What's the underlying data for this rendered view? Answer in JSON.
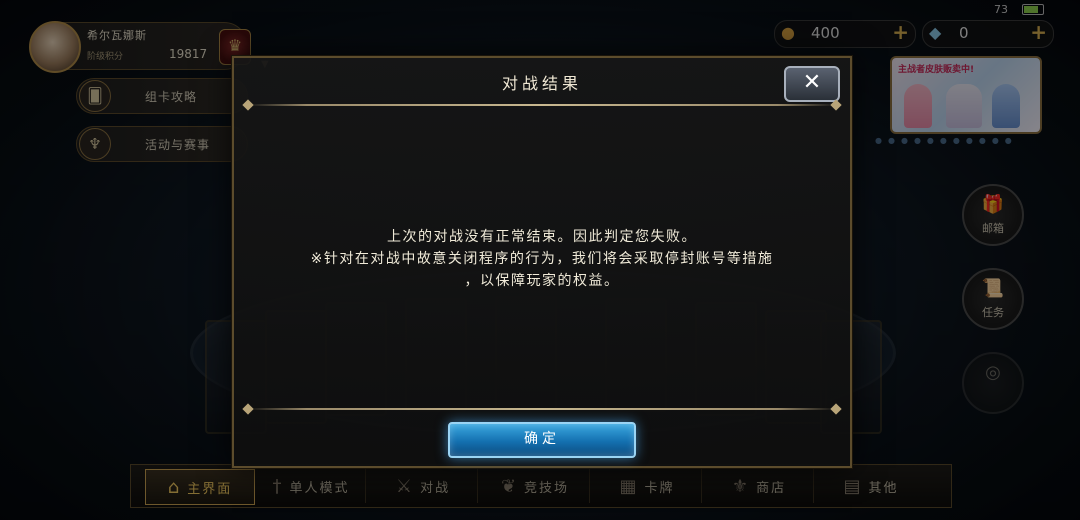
{
  "status_bar": {
    "battery": "73"
  },
  "profile": {
    "name": "希尔瓦娜斯",
    "rank_label": "阶级积分",
    "rank_value": "19817"
  },
  "side_buttons": [
    {
      "label": "组卡攻略",
      "icon": "cards-icon"
    },
    {
      "label": "活动与赛事",
      "icon": "trophy-icon"
    }
  ],
  "resources": {
    "gold": {
      "value": "400",
      "icon": "gold-coin-icon"
    },
    "crystal": {
      "value": "0",
      "icon": "crystal-icon"
    }
  },
  "banner": {
    "title": "主战者皮肤贩卖中!"
  },
  "right_buttons": [
    {
      "label": "邮箱",
      "icon": "gift-icon"
    },
    {
      "label": "任务",
      "icon": "scroll-icon"
    }
  ],
  "nav": [
    {
      "label": "主界面",
      "icon": "home-icon",
      "active": true
    },
    {
      "label": "单人模式",
      "icon": "sword-icon",
      "active": false
    },
    {
      "label": "对战",
      "icon": "crossed-swords-icon",
      "active": false
    },
    {
      "label": "竞技场",
      "icon": "laurel-icon",
      "active": false
    },
    {
      "label": "卡牌",
      "icon": "cards-icon",
      "active": false
    },
    {
      "label": "商店",
      "icon": "shop-icon",
      "active": false
    },
    {
      "label": "其他",
      "icon": "more-icon",
      "active": false
    }
  ],
  "dialog": {
    "title": "对战结果",
    "message_lines": [
      "上次的对战没有正常结束。因此判定您失败。",
      "※针对在对战中故意关闭程序的行为，我们将会采取停封账号等措施",
      "，以保障玩家的权益。"
    ],
    "confirm_label": "确定",
    "close_label": "✕"
  },
  "colors": {
    "accent_gold": "#c8a050",
    "confirm_blue": "#1470b0",
    "battery_green": "#8fd14f"
  }
}
